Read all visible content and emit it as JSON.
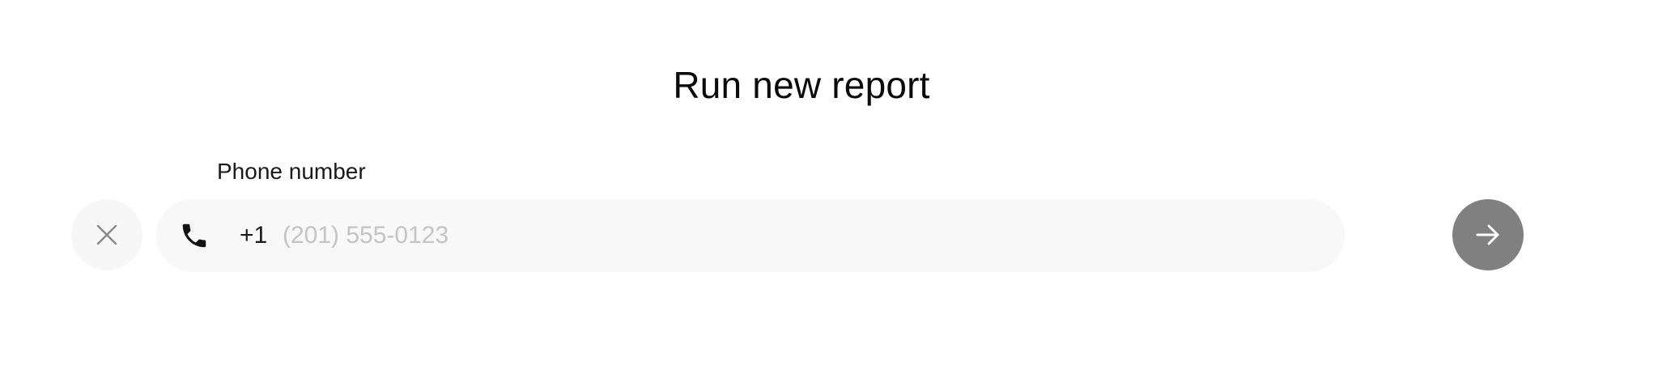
{
  "header": {
    "title": "Run new report"
  },
  "form": {
    "phone_label": "Phone number",
    "country_code": "+1",
    "phone_value": "",
    "phone_placeholder": "(201) 555-0123"
  },
  "icons": {
    "clear": "close-icon",
    "phone": "phone-icon",
    "submit": "arrow-right-icon"
  },
  "colors": {
    "submit_button_bg": "#808080",
    "field_bg": "#f8f8f8",
    "placeholder": "#c4c4c4"
  }
}
